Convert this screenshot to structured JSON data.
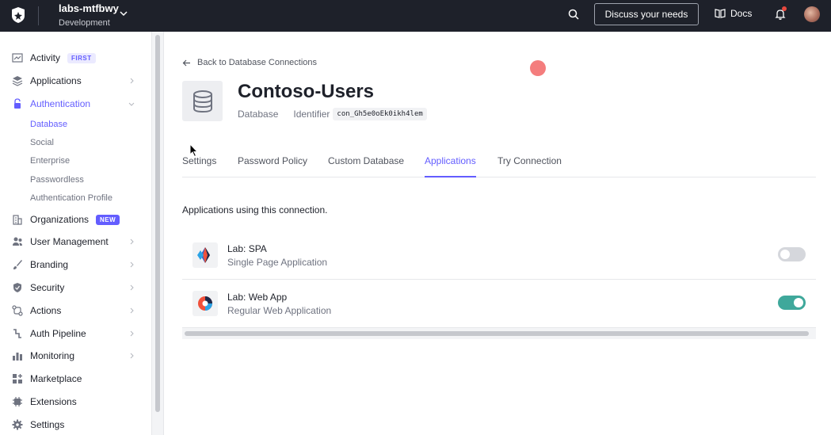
{
  "topbar": {
    "tenant_name": "labs-mtfbwy",
    "tenant_env": "Development",
    "discuss_label": "Discuss your needs",
    "docs_label": "Docs"
  },
  "sidebar": {
    "items": [
      {
        "label": "Activity",
        "icon": "activity-icon",
        "badge": "FIRST"
      },
      {
        "label": "Applications",
        "icon": "layers-icon"
      },
      {
        "label": "Authentication",
        "icon": "lock-icon",
        "expanded": true
      },
      {
        "label": "Organizations",
        "icon": "building-icon",
        "badge": "NEW"
      },
      {
        "label": "User Management",
        "icon": "users-icon"
      },
      {
        "label": "Branding",
        "icon": "brush-icon"
      },
      {
        "label": "Security",
        "icon": "shield-icon"
      },
      {
        "label": "Actions",
        "icon": "actions-icon"
      },
      {
        "label": "Auth Pipeline",
        "icon": "pipeline-icon"
      },
      {
        "label": "Monitoring",
        "icon": "chart-icon"
      },
      {
        "label": "Marketplace",
        "icon": "grid-plus-icon"
      },
      {
        "label": "Extensions",
        "icon": "gear-chip-icon"
      },
      {
        "label": "Settings",
        "icon": "gear-icon"
      }
    ],
    "auth_sub": [
      "Database",
      "Social",
      "Enterprise",
      "Passwordless",
      "Authentication Profile"
    ]
  },
  "main": {
    "back_label": "Back to Database Connections",
    "title": "Contoso-Users",
    "type_label": "Database",
    "identifier_label": "Identifier",
    "identifier_value": "con_Gh5e0oEk0ikh4lem",
    "tabs": [
      "Settings",
      "Password Policy",
      "Custom Database",
      "Applications",
      "Try Connection"
    ],
    "active_tab": "Applications",
    "section_desc": "Applications using this connection.",
    "apps": [
      {
        "name": "Lab: SPA",
        "type": "Single Page Application",
        "enabled": false
      },
      {
        "name": "Lab: Web App",
        "type": "Regular Web Application",
        "enabled": true
      }
    ]
  },
  "colors": {
    "accent": "#635dff",
    "toggle_on": "#3fa89b",
    "topbar_bg": "#1e212a"
  }
}
